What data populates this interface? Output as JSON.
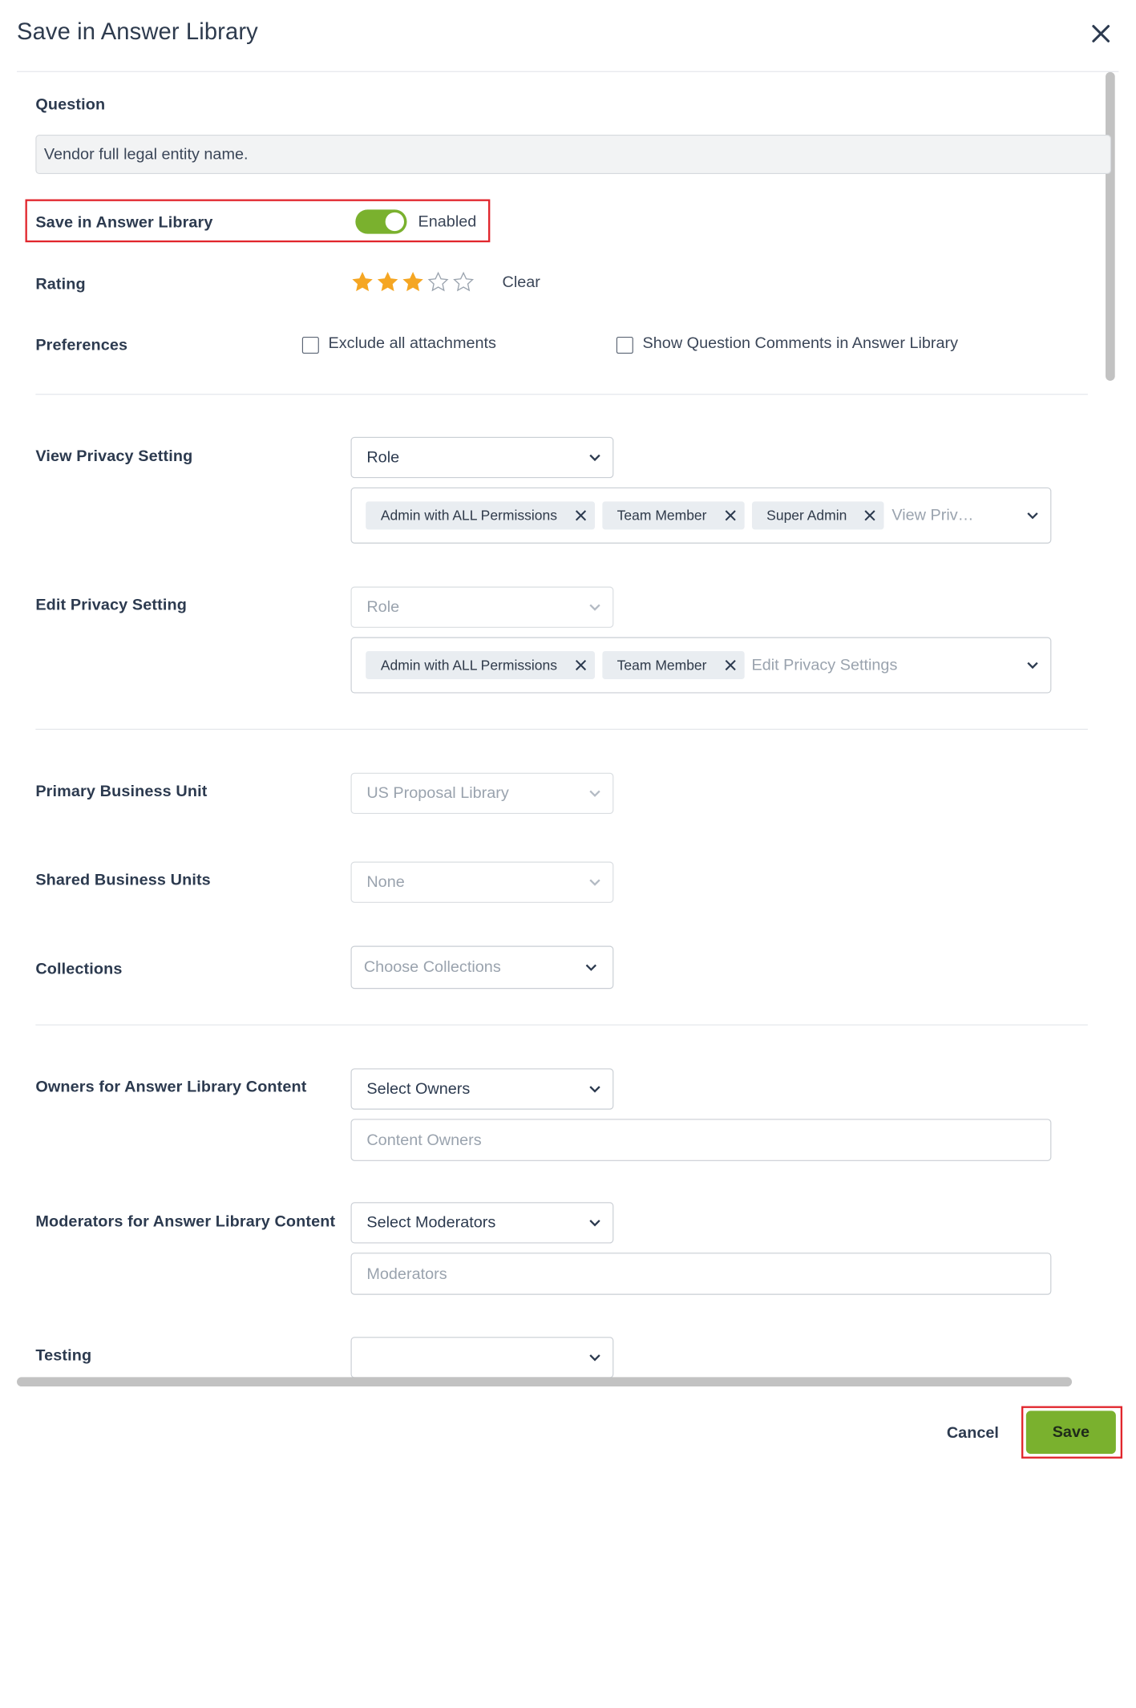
{
  "dialog": {
    "title": "Save in Answer Library"
  },
  "question": {
    "label": "Question",
    "value": "Vendor full legal entity name."
  },
  "save_library": {
    "label": "Save in Answer Library",
    "toggle_on": true,
    "status": "Enabled"
  },
  "rating": {
    "label": "Rating",
    "value": 3,
    "max": 5,
    "clear_label": "Clear",
    "star_color": "#f5a623"
  },
  "preferences": {
    "label": "Preferences",
    "exclude_attachments": "Exclude all attachments",
    "show_comments": "Show Question Comments in Answer Library"
  },
  "view_privacy": {
    "label": "View Privacy Setting",
    "type_value": "Role",
    "chips": [
      "Admin with ALL Permissions",
      "Team Member",
      "Super Admin"
    ],
    "placeholder": "View Priv…"
  },
  "edit_privacy": {
    "label": "Edit Privacy Setting",
    "type_value": "Role",
    "chips": [
      "Admin with ALL Permissions",
      "Team Member"
    ],
    "placeholder": "Edit Privacy Settings"
  },
  "primary_bu": {
    "label": "Primary Business Unit",
    "value": "US Proposal Library"
  },
  "shared_bu": {
    "label": "Shared Business Units",
    "value": "None"
  },
  "collections": {
    "label": "Collections",
    "placeholder": "Choose Collections"
  },
  "owners": {
    "label": "Owners for Answer Library Content",
    "select_value": "Select Owners",
    "input_placeholder": "Content Owners"
  },
  "moderators": {
    "label": "Moderators for Answer Library Content",
    "select_value": "Select Moderators",
    "input_placeholder": "Moderators"
  },
  "testing": {
    "label": "Testing",
    "value": ""
  },
  "footer": {
    "cancel_label": "Cancel",
    "save_label": "Save"
  },
  "colors": {
    "accent": "#7ab12e",
    "highlight": "#e1262d"
  }
}
